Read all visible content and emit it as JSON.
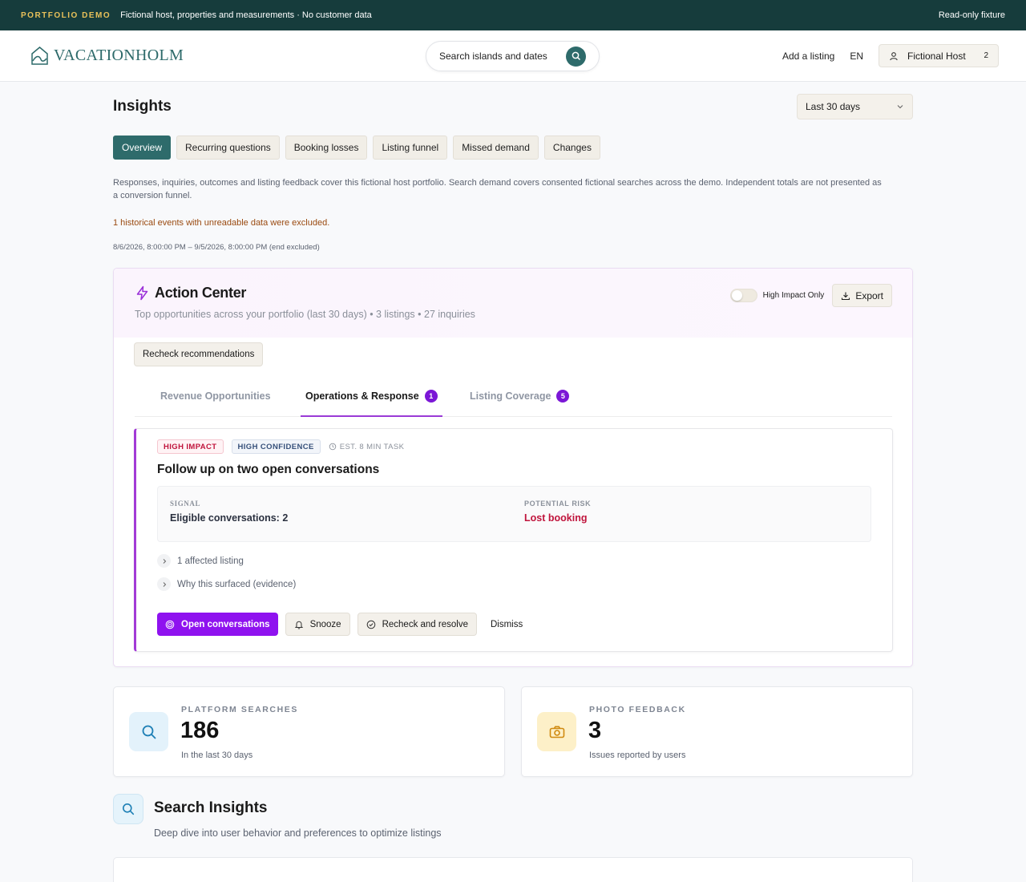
{
  "banner": {
    "tag": "PORTFOLIO DEMO",
    "description": "Fictional host, properties and measurements · No customer data",
    "right": "Read-only fixture"
  },
  "header": {
    "brand": "VACATIONHOLM",
    "search_label": "Search islands and dates",
    "add_listing": "Add a listing",
    "language": "EN",
    "user_name": "Fictional Host",
    "user_count": "2"
  },
  "page": {
    "title": "Insights",
    "date_range": "Last 30 days",
    "tabs": [
      {
        "label": "Overview"
      },
      {
        "label": "Recurring questions"
      },
      {
        "label": "Booking losses"
      },
      {
        "label": "Listing funnel"
      },
      {
        "label": "Missed demand"
      },
      {
        "label": "Changes"
      }
    ],
    "intro": "Responses, inquiries, outcomes and listing feedback cover this fictional host portfolio. Search demand covers consented fictional searches across the demo. Independent totals are not presented as a conversion funnel.",
    "warning": "1 historical events with unreadable data were excluded.",
    "period": "8/6/2026, 8:00:00 PM – 9/5/2026, 8:00:00 PM (end excluded)"
  },
  "action_center": {
    "title": "Action Center",
    "subtitle": "Top opportunities across your portfolio (last 30 days) • 3 listings • 27 inquiries",
    "toggle_label": "High Impact Only",
    "export_label": "Export",
    "recheck_label": "Recheck recommendations",
    "tabs": [
      {
        "label": "Revenue Opportunities",
        "badge": ""
      },
      {
        "label": "Operations & Response",
        "badge": "1"
      },
      {
        "label": "Listing Coverage",
        "badge": "5"
      }
    ],
    "card": {
      "chip_impact": "HIGH IMPACT",
      "chip_confidence": "HIGH CONFIDENCE",
      "chip_estimate": "EST. 8 MIN TASK",
      "title": "Follow up on two open conversations",
      "signal_label": "SIGNAL",
      "signal_value": "Eligible conversations: 2",
      "risk_label": "POTENTIAL RISK",
      "risk_value": "Lost booking",
      "expander_listing": "1 affected listing",
      "expander_evidence": "Why this surfaced (evidence)",
      "btn_open": "Open conversations",
      "btn_snooze": "Snooze",
      "btn_resolve": "Recheck and resolve",
      "btn_dismiss": "Dismiss"
    }
  },
  "stats": [
    {
      "label": "PLATFORM SEARCHES",
      "value": "186",
      "caption": "In the last 30 days"
    },
    {
      "label": "PHOTO FEEDBACK",
      "value": "3",
      "caption": "Issues reported by users"
    }
  ],
  "search_insights": {
    "title": "Search Insights",
    "subtitle": "Deep dive into user behavior and preferences to optimize listings"
  },
  "colors": {
    "brand_dark": "#163c3c",
    "brand_teal": "#2e6b6b",
    "accent_purple": "#8f12ef",
    "risk_red": "#c0143c"
  }
}
